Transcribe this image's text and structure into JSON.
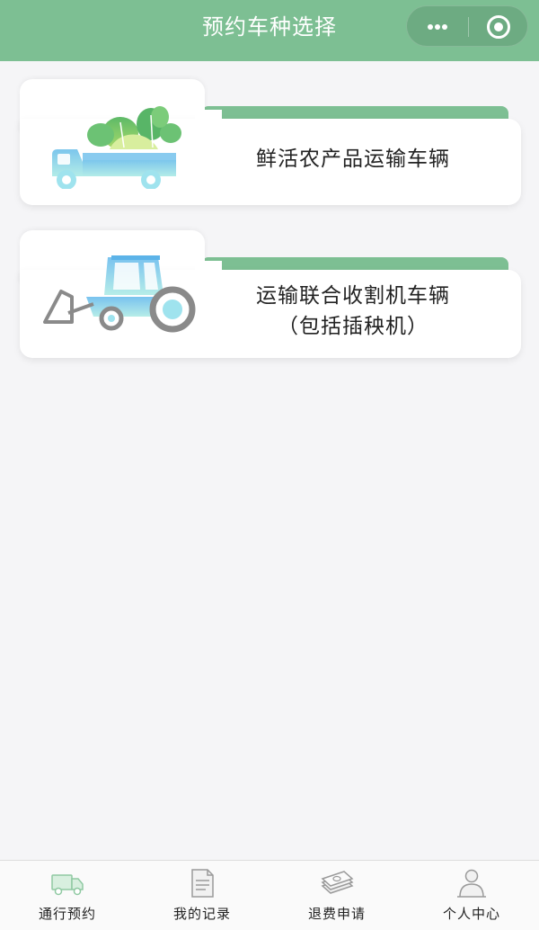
{
  "header": {
    "title": "预约车种选择",
    "more_icon": "more-dots-icon",
    "close_icon": "target-close-icon",
    "background_color": "#7dbf93"
  },
  "cards": [
    {
      "label_line1": "鲜活农产品运输车辆",
      "label_line2": "",
      "icon": "vegetable-truck-icon"
    },
    {
      "label_line1": "运输联合收割机车辆",
      "label_line2": "（包括插秧机）",
      "icon": "tractor-icon"
    }
  ],
  "tabbar": {
    "items": [
      {
        "label": "通行预约",
        "icon": "truck-icon",
        "active": true
      },
      {
        "label": "我的记录",
        "icon": "document-icon",
        "active": false
      },
      {
        "label": "退费申请",
        "icon": "money-stack-icon",
        "active": false
      },
      {
        "label": "个人中心",
        "icon": "person-icon",
        "active": false
      }
    ]
  },
  "colors": {
    "accent_green": "#7dbf93",
    "icon_blue": "#8ad3f0",
    "page_background": "#f5f5f7"
  }
}
